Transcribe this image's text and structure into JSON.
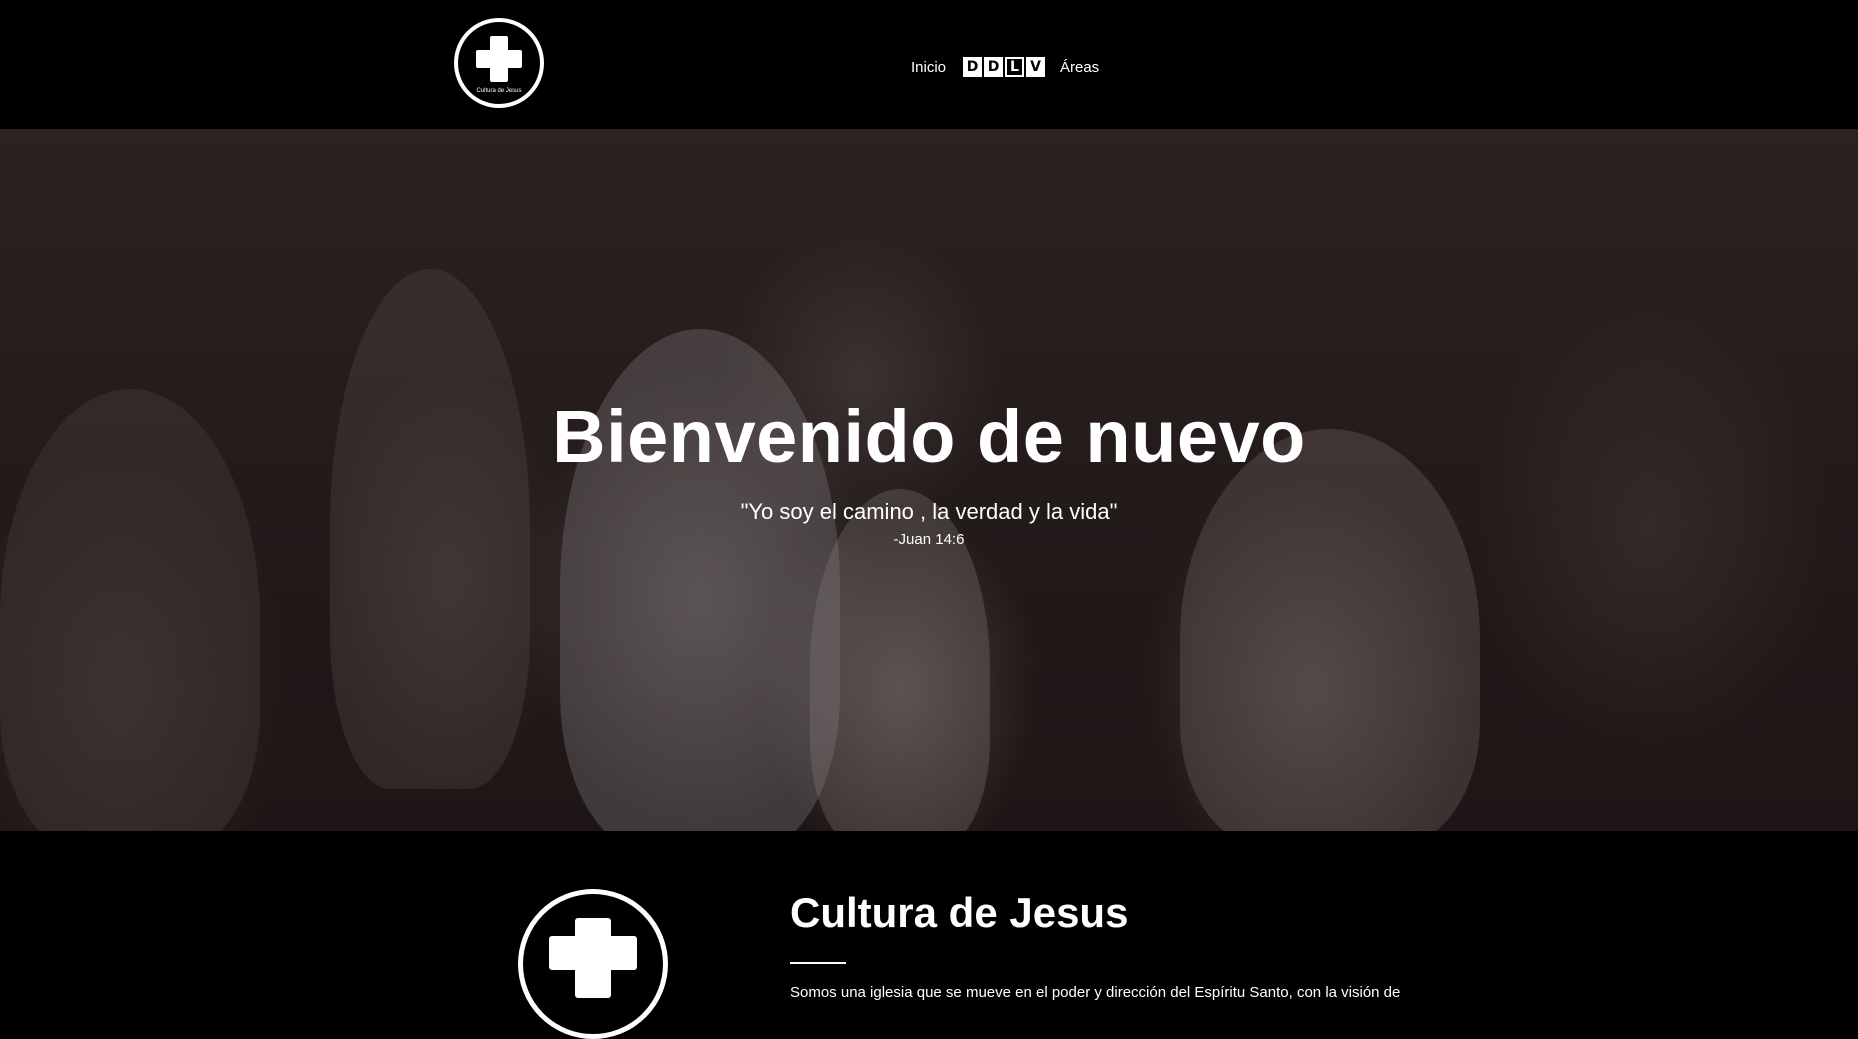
{
  "header": {
    "logo_text": "Cultura de Jesus",
    "nav": {
      "inicio": "Inicio",
      "ddlv_letters": [
        "D",
        "D",
        "L",
        "V"
      ],
      "areas": "Áreas"
    }
  },
  "hero": {
    "title": "Bienvenido de nuevo",
    "quote": "\"Yo soy el camino , la verdad y la vida\"",
    "reference": "-Juan 14:6"
  },
  "about": {
    "title": "Cultura de Jesus",
    "text": "Somos una iglesia que se mueve en el poder y dirección del Espíritu Santo, con la visión de"
  },
  "colors": {
    "background": "#000000",
    "text": "#ffffff",
    "hero_tint": "#2b2222"
  },
  "icons": {
    "logo": "cross-icon"
  }
}
